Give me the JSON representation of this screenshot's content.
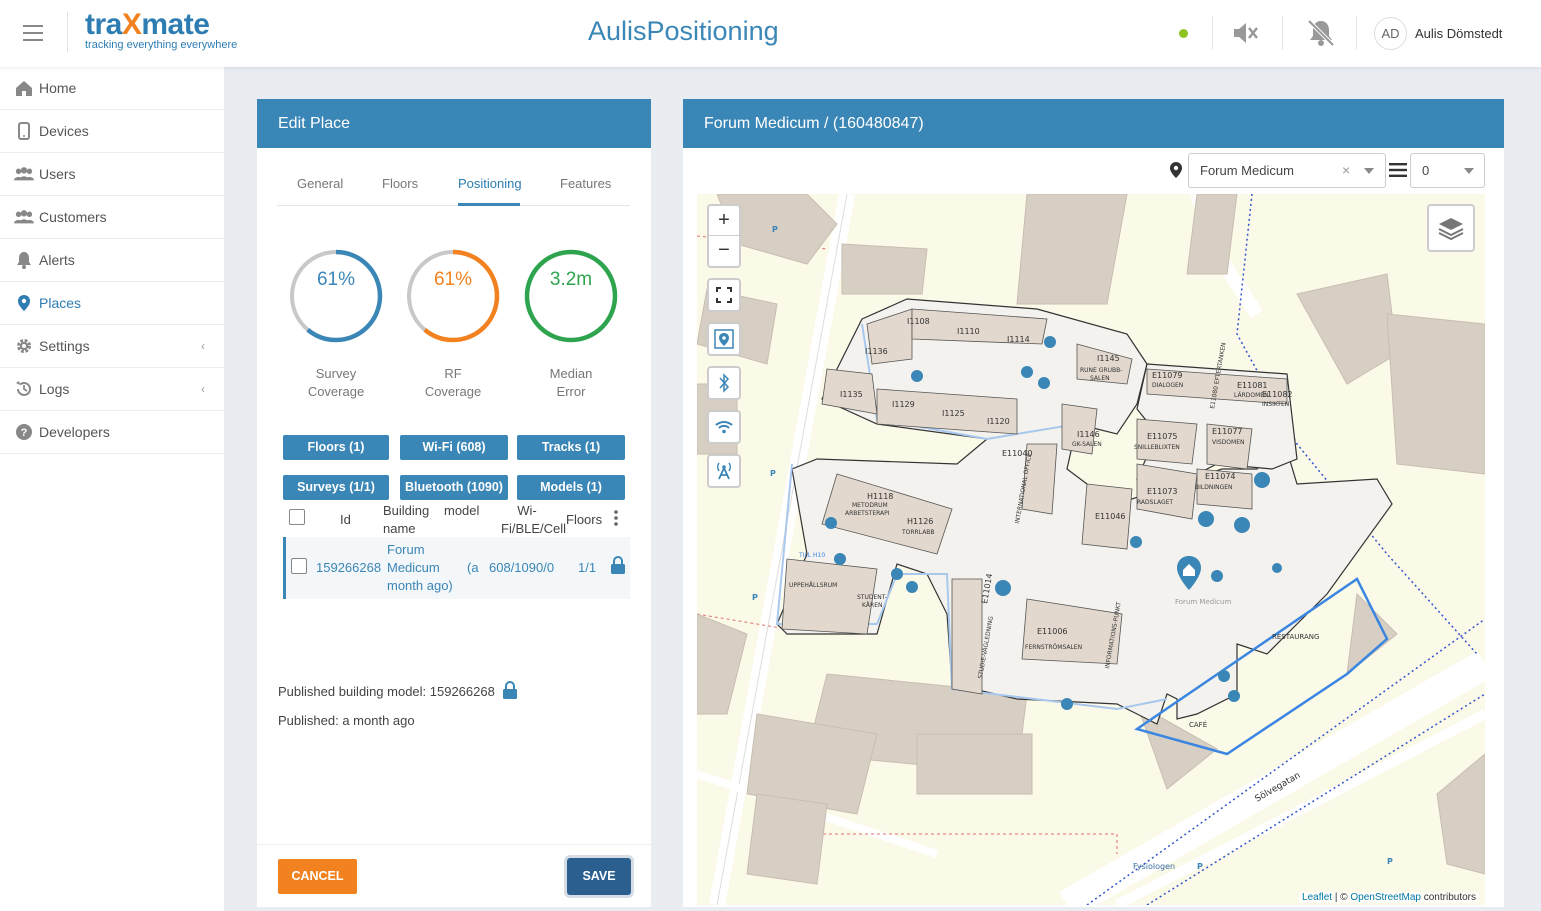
{
  "header": {
    "logo_main_a": "tra",
    "logo_main_x": "X",
    "logo_main_b": "mate",
    "logo_sub": "tracking everything everywhere",
    "app_title": "AulisPositioning",
    "user_initials": "AD",
    "user_name": "Aulis Dömstedt",
    "status_color": "#8fc31f"
  },
  "sidebar": {
    "items": [
      {
        "label": "Home",
        "icon": "home-icon"
      },
      {
        "label": "Devices",
        "icon": "device-icon"
      },
      {
        "label": "Users",
        "icon": "users-icon"
      },
      {
        "label": "Customers",
        "icon": "customers-icon"
      },
      {
        "label": "Alerts",
        "icon": "bell-icon"
      },
      {
        "label": "Places",
        "icon": "map-pin-icon",
        "active": true
      },
      {
        "label": "Settings",
        "icon": "gear-icon",
        "chevron": "‹"
      },
      {
        "label": "Logs",
        "icon": "history-icon",
        "chevron": "‹"
      },
      {
        "label": "Developers",
        "icon": "help-icon"
      }
    ]
  },
  "edit_place": {
    "title": "Edit Place",
    "tabs": [
      "General",
      "Floors",
      "Positioning",
      "Features"
    ],
    "active_tab": "Positioning",
    "gauges": [
      {
        "value": "61%",
        "fraction": 0.61,
        "label_1": "Survey",
        "label_2": "Coverage",
        "color": "#3a86b6"
      },
      {
        "value": "61%",
        "fraction": 0.61,
        "label_1": "RF",
        "label_2": "Coverage",
        "color": "#f2821f"
      },
      {
        "value": "3.2m",
        "fraction": 1.0,
        "label_1": "Median",
        "label_2": "Error",
        "color": "#2ea44f"
      }
    ],
    "buttons_row1": [
      "Floors (1)",
      "Wi-Fi (608)",
      "Tracks (1)"
    ],
    "buttons_row2": [
      "Surveys (1/1)",
      "Bluetooth (1090)",
      "Models (1)"
    ],
    "table": {
      "headers": {
        "id": "Id",
        "building_1": "Building",
        "building_2": "name",
        "model": "model",
        "wifi_1": "Wi-",
        "wifi_2": "Fi/BLE/Cell",
        "floors": "Floors"
      },
      "row": {
        "id": "159266268",
        "name_1": "Forum",
        "name_2": "Medicum",
        "name_3": "month ago)",
        "model": "(a",
        "wifi": "608/1090/0",
        "floors": "1/1"
      }
    },
    "published_model": "Published building model: 159266268",
    "published_time": "Published: a month ago",
    "cancel_label": "CANCEL",
    "save_label": "SAVE"
  },
  "map_panel": {
    "title": "Forum Medicum /  (160480847)",
    "building_select": "Forum Medicum",
    "building_clear": "×",
    "floor_select": "0",
    "attribution_leaflet": "Leaflet",
    "attribution_sep": " | © ",
    "attribution_osm": "OpenStreetMap",
    "attribution_tail": " contributors",
    "street_label": "Sölvegatan",
    "poi_label": "Fysiologen",
    "center_label": "Forum Medicum",
    "rooms": [
      "I108",
      "I1110",
      "I1114",
      "I1136",
      "I1145",
      "RUNE GRUBB-SALEN",
      "I135",
      "I1129",
      "I1125",
      "I1120",
      "I1146",
      "GK-SALEN",
      "E11040",
      "INTERNATIONAL OFFICE",
      "E11079",
      "DIALOGEN",
      "E11080",
      "EFTERTANKEN",
      "E11081",
      "LÅRDOMEN",
      "E11082",
      "INSIKTEN",
      "E11075",
      "SNILLEBLIXTEN",
      "E11077",
      "VISDOMEN",
      "E11073",
      "RADSLAGET",
      "E11074",
      "BILDNINGEN",
      "E11046",
      "H1118",
      "METODRUM",
      "ARBETSTERAPI",
      "H1126",
      "TORRLABB",
      "TILL H10",
      "UPPEHÅLLSRUM",
      "STUDENT-KÅREN",
      "E11014",
      "STUDIE-VÄGLEDNING",
      "E11006",
      "FERNSTRÖMSALEN",
      "INFORMATIONS-PUNKT",
      "RESTAURANG",
      "CAFÉ"
    ]
  }
}
